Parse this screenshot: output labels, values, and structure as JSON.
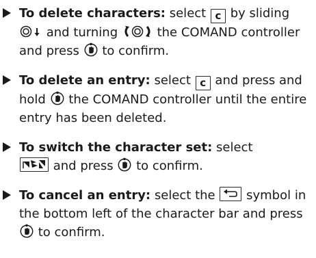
{
  "items": [
    {
      "heading": "To delete characters:",
      "t1": "select",
      "key": "c",
      "t2": "by sliding",
      "t3": "and turning",
      "t4": "the COMAND controller and press",
      "t5": "to confirm."
    },
    {
      "heading": "To delete an entry:",
      "t1": "select",
      "key": "c",
      "t2": "and press and hold",
      "t3": "the COMAND controller until the entire entry has been deleted."
    },
    {
      "heading": "To switch the character set:",
      "t1": "select",
      "t2": "and press",
      "t3": "to confirm."
    },
    {
      "heading": "To cancel an entry:",
      "t1": "select the",
      "t2": "symbol in the bottom left of the character bar and press",
      "t3": "to confirm."
    }
  ],
  "icons": {
    "slide": "controller-slide-down-icon",
    "turn": "controller-turn-icon",
    "press": "controller-press-icon",
    "charset": "character-set-icon",
    "back": "back-arrow-icon"
  }
}
